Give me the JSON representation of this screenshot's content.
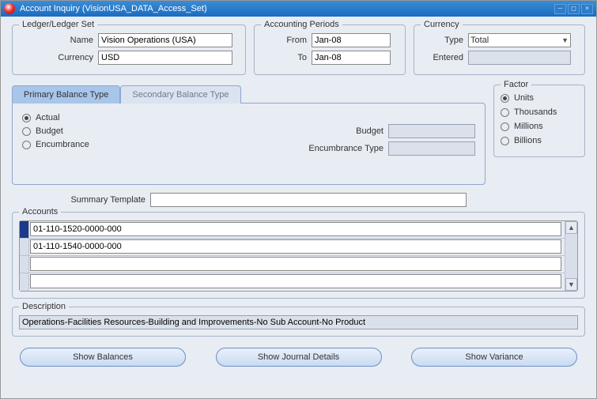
{
  "window": {
    "title": "Account Inquiry (VisionUSA_DATA_Access_Set)"
  },
  "ledger": {
    "title": "Ledger/Ledger Set",
    "name_label": "Name",
    "name_value": "Vision Operations (USA)",
    "currency_label": "Currency",
    "currency_value": "USD"
  },
  "periods": {
    "title": "Accounting Periods",
    "from_label": "From",
    "from_value": "Jan-08",
    "to_label": "To",
    "to_value": "Jan-08"
  },
  "currency": {
    "title": "Currency",
    "type_label": "Type",
    "type_value": "Total",
    "entered_label": "Entered",
    "entered_value": ""
  },
  "tabs": {
    "primary": "Primary Balance Type",
    "secondary": "Secondary Balance Type"
  },
  "balance": {
    "actual": "Actual",
    "budget": "Budget",
    "encumbrance": "Encumbrance",
    "budget_label": "Budget",
    "budget_value": "",
    "enc_label": "Encumbrance Type",
    "enc_value": ""
  },
  "factor": {
    "title": "Factor",
    "units": "Units",
    "thousands": "Thousands",
    "millions": "Millions",
    "billions": "Billions"
  },
  "summary": {
    "label": "Summary Template",
    "value": ""
  },
  "accounts": {
    "title": "Accounts",
    "rows": [
      "01-110-1520-0000-000",
      "01-110-1540-0000-000",
      "",
      ""
    ]
  },
  "description": {
    "title": "Description",
    "value": "Operations-Facilities Resources-Building and Improvements-No Sub Account-No Product"
  },
  "buttons": {
    "balances": "Show Balances",
    "journal": "Show Journal Details",
    "variance": "Show Variance"
  }
}
